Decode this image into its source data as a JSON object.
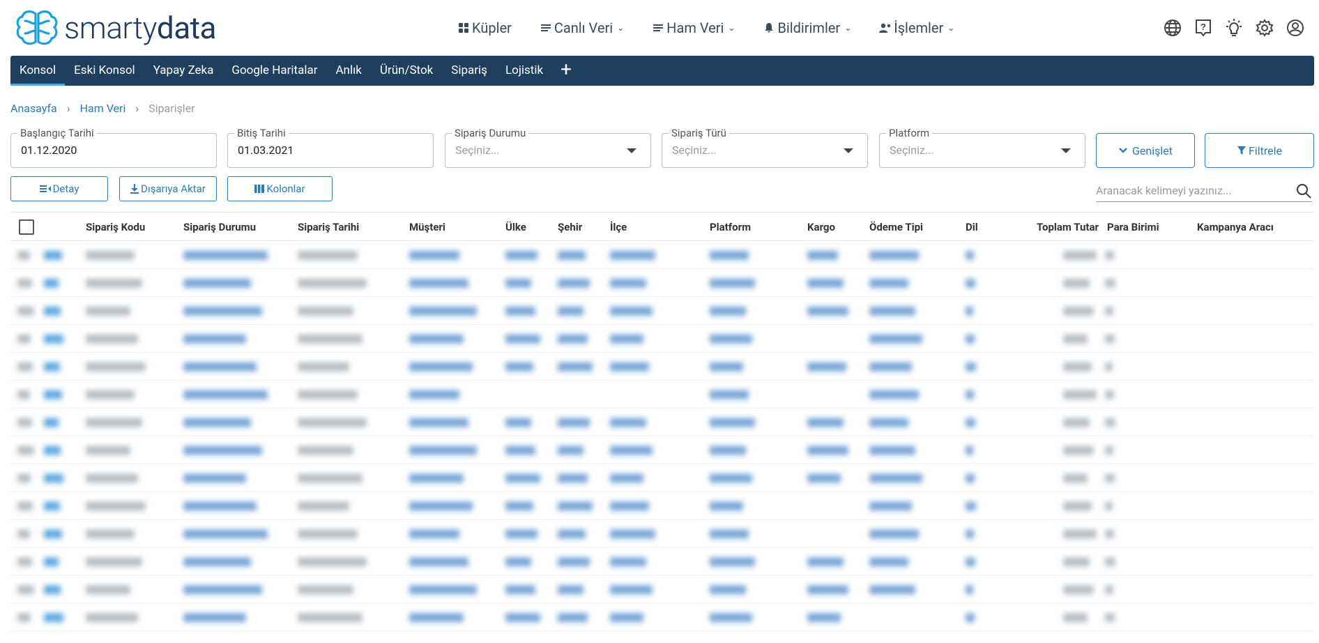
{
  "app": {
    "logo_text_light": "smarty",
    "logo_text_bold": "data"
  },
  "topnav": [
    {
      "label": "Küpler",
      "icon": "cubes-icon",
      "dropdown": false
    },
    {
      "label": "Canlı Veri",
      "icon": "list-icon",
      "dropdown": true
    },
    {
      "label": "Ham Veri",
      "icon": "list-icon",
      "dropdown": true
    },
    {
      "label": "Bildirimler",
      "icon": "bell-icon",
      "dropdown": true
    },
    {
      "label": "İşlemler",
      "icon": "user-gear-icon",
      "dropdown": true
    }
  ],
  "top_icons": [
    "globe-icon",
    "help-icon",
    "lightbulb-icon",
    "settings-icon",
    "account-icon"
  ],
  "tabs": [
    {
      "label": "Konsol",
      "active": true
    },
    {
      "label": "Eski Konsol",
      "active": false
    },
    {
      "label": "Yapay Zeka",
      "active": false
    },
    {
      "label": "Google Haritalar",
      "active": false
    },
    {
      "label": "Anlık",
      "active": false
    },
    {
      "label": "Ürün/Stok",
      "active": false
    },
    {
      "label": "Sipariş",
      "active": false
    },
    {
      "label": "Lojistik",
      "active": false
    }
  ],
  "breadcrumb": {
    "home": "Anasayfa",
    "section": "Ham Veri",
    "current": "Siparişler",
    "separator": "›"
  },
  "filters": {
    "start_date": {
      "label": "Başlangıç Tarihi",
      "value": "01.12.2020"
    },
    "end_date": {
      "label": "Bitiş Tarihi",
      "value": "01.03.2021"
    },
    "order_status": {
      "label": "Sipariş Durumu",
      "placeholder": "Seçiniz..."
    },
    "order_type": {
      "label": "Sipariş Türü",
      "placeholder": "Seçiniz..."
    },
    "platform": {
      "label": "Platform",
      "placeholder": "Seçiniz..."
    },
    "expand_label": "Genişlet",
    "filter_label": "Filtrele"
  },
  "actions": {
    "detail_label": "Detay",
    "export_label": "Dışarıya Aktar",
    "columns_label": "Kolonlar"
  },
  "search": {
    "placeholder": "Aranacak kelimeyi yazınız..."
  },
  "table": {
    "columns": [
      "Sipariş Kodu",
      "Sipariş Durumu",
      "Sipariş Tarihi",
      "Müşteri",
      "Ülke",
      "Şehir",
      "İlçe",
      "Platform",
      "Kargo",
      "Ödeme Tipi",
      "Dil",
      "Toplam Tutar",
      "Para Birimi",
      "Kampanya Aracı"
    ],
    "row_count": 14
  },
  "colors": {
    "navbar": "#1e405e",
    "accent": "#2a7bb8",
    "logo": "#1e3b5c"
  }
}
